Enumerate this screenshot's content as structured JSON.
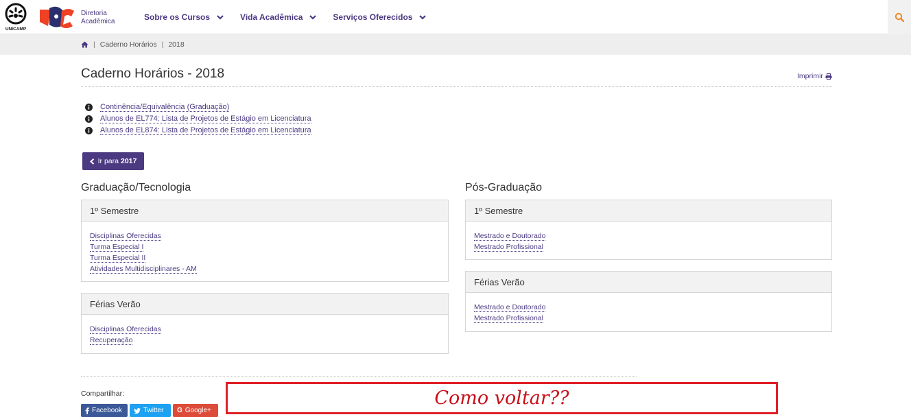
{
  "header": {
    "unicamp_logo_text": "UNICAMP",
    "brand_line1": "Diretoria",
    "brand_line2": "Acadêmica",
    "nav": [
      {
        "label": "Sobre os Cursos"
      },
      {
        "label": "Vida Acadêmica"
      },
      {
        "label": "Serviços Oferecidos"
      }
    ],
    "search_icon": "search-icon"
  },
  "breadcrumb": {
    "home_icon": "home-icon",
    "items": [
      "Caderno Horários",
      "2018"
    ]
  },
  "page": {
    "title": "Caderno Horários - 2018",
    "print_label": "Imprimir",
    "info_links": [
      "Continência/Equivalência (Graduação)",
      "Alunos de EL774: Lista de Projetos de Estágio em Licenciatura",
      "Alunos de EL874: Lista de Projetos de Estágio em Licenciatura"
    ],
    "prev_button": {
      "prefix": "Ir para",
      "year": "2017"
    }
  },
  "graduacao": {
    "title": "Graduação/Tecnologia",
    "panels": [
      {
        "heading": "1º Semestre",
        "links": [
          "Disciplinas Oferecidas",
          "Turma Especial I",
          "Turma Especial II",
          "Atividades Multidisciplinares - AM"
        ]
      },
      {
        "heading": "Férias Verão",
        "links": [
          "Disciplinas Oferecidas",
          "Recuperação"
        ]
      }
    ]
  },
  "posgraduacao": {
    "title": "Pós-Graduação",
    "panels": [
      {
        "heading": "1º Semestre",
        "links": [
          "Mestrado e Doutorado",
          "Mestrado Profissional"
        ]
      },
      {
        "heading": "Férias Verão",
        "links": [
          "Mestrado e Doutorado",
          "Mestrado Profissional"
        ]
      }
    ]
  },
  "share": {
    "label": "Compartilhar:",
    "facebook": "Facebook",
    "twitter": "Twitter",
    "google": "Google+"
  },
  "annotation": {
    "text": "Como voltar??"
  },
  "colors": {
    "accent": "#4b3a82",
    "annotation_red": "#e01f26",
    "search_icon": "#f08a24"
  }
}
